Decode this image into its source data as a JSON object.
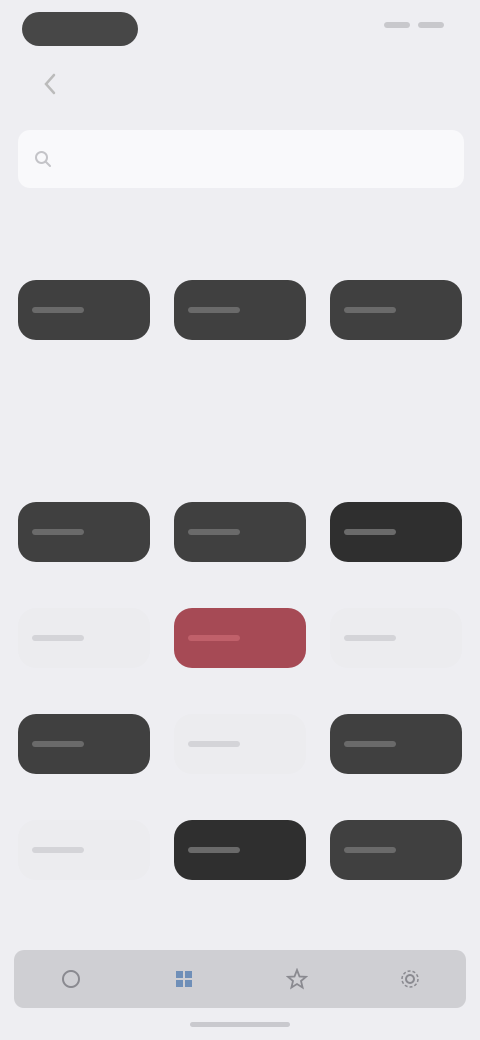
{
  "status": {
    "pill": "",
    "right": ""
  },
  "header": {
    "title": ""
  },
  "search": {
    "placeholder": ""
  },
  "sections": [
    {
      "title": "",
      "themes": [
        {
          "label": "",
          "style": "dark"
        },
        {
          "label": "",
          "style": "dark"
        },
        {
          "label": "",
          "style": "dark"
        }
      ]
    },
    {
      "title": "",
      "themes": [
        {
          "label": "",
          "style": "dark"
        },
        {
          "label": "",
          "style": "dark"
        },
        {
          "label": "",
          "style": "darker"
        },
        {
          "label": "",
          "style": "light"
        },
        {
          "label": "",
          "style": "red"
        },
        {
          "label": "",
          "style": "light"
        },
        {
          "label": "",
          "style": "dark"
        },
        {
          "label": "",
          "style": "light"
        },
        {
          "label": "",
          "style": "dark"
        },
        {
          "label": "",
          "style": "light"
        },
        {
          "label": "",
          "style": "darker"
        },
        {
          "label": "",
          "style": "dark"
        }
      ]
    }
  ],
  "bottom_bar": {
    "items": [
      {
        "label": "",
        "icon": "palette-icon"
      },
      {
        "label": "",
        "icon": "grid-icon"
      },
      {
        "label": "",
        "icon": "star-icon"
      },
      {
        "label": "",
        "icon": "settings-icon"
      }
    ]
  },
  "colors": {
    "background": "#eeeef2",
    "accent": "#a64a55"
  }
}
